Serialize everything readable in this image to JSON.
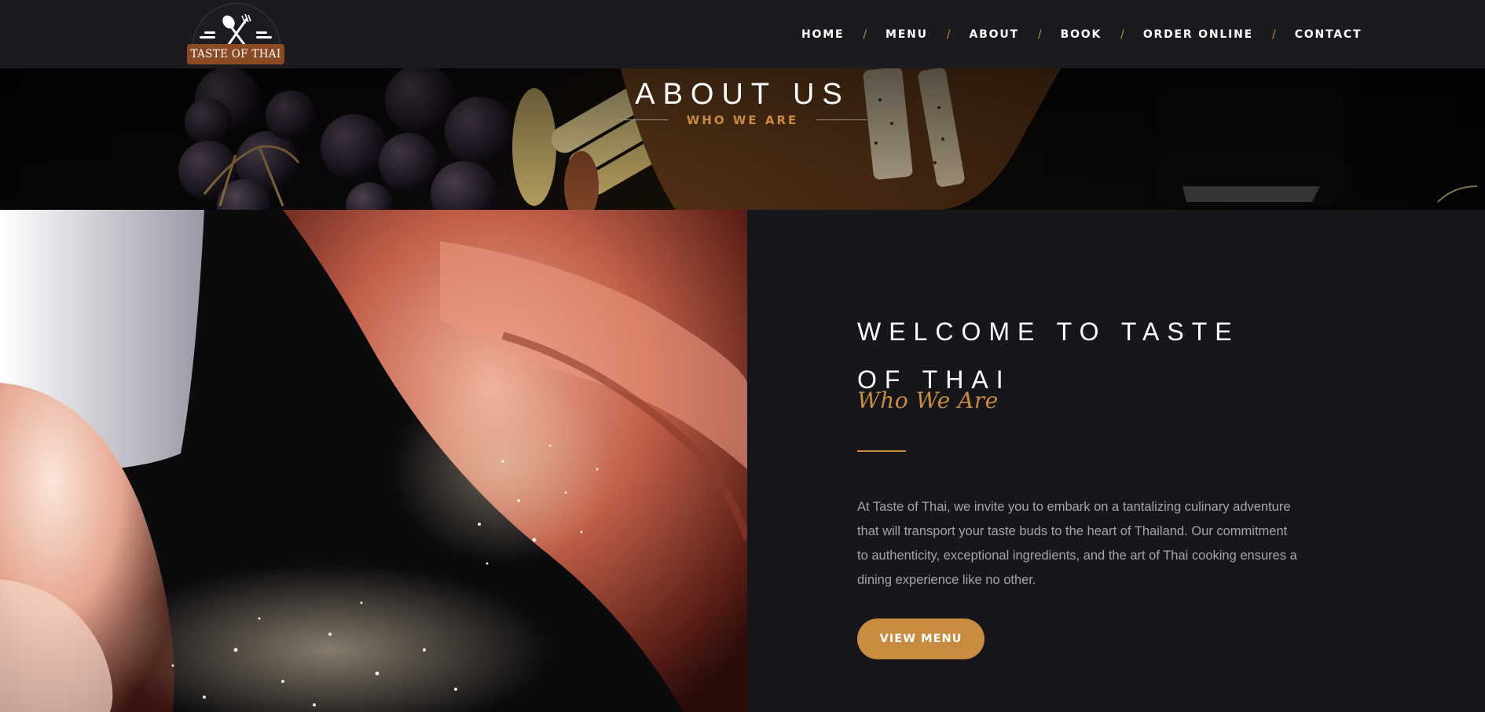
{
  "brand": {
    "name": "TASTE OF THAI"
  },
  "nav": {
    "items": [
      {
        "label": "HOME"
      },
      {
        "label": "MENU"
      },
      {
        "label": "ABOUT"
      },
      {
        "label": "BOOK"
      },
      {
        "label": "ORDER ONLINE"
      },
      {
        "label": "CONTACT"
      }
    ],
    "separator": "/"
  },
  "banner": {
    "title": "ABOUT US",
    "subtitle": "WHO WE ARE"
  },
  "about": {
    "title": "WELCOME TO TASTE OF THAI",
    "script_subtitle": "Who We Are",
    "paragraph": "At Taste of Thai, we invite you to embark on a tantalizing culinary adventure that will transport your taste buds to the heart of Thailand. Our commitment to authenticity, exceptional ingredients, and the art of Thai cooking ensures a dining experience like no other.",
    "button_label": "VIEW MENU"
  },
  "colors": {
    "accent": "#c98b3f",
    "background": "#17161b",
    "header": "#1a1a1f",
    "logo_plate": "#8a4a24"
  }
}
